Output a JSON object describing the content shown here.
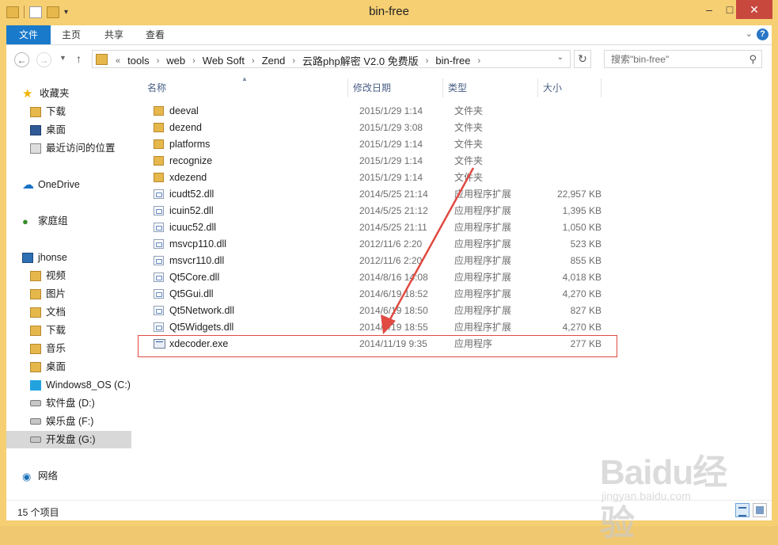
{
  "window": {
    "title": "bin-free"
  },
  "ribbon": {
    "tabs": [
      "文件",
      "主页",
      "共享",
      "查看"
    ]
  },
  "address": {
    "crumbs": [
      "tools",
      "web",
      "Web Soft",
      "Zend",
      "云路php解密 V2.0 免费版",
      "bin-free"
    ],
    "search_placeholder": "搜索\"bin-free\""
  },
  "nav": {
    "favorites_label": "收藏夹",
    "favorites": [
      "下载",
      "桌面",
      "最近访问的位置"
    ],
    "onedrive": "OneDrive",
    "homegroup": "家庭组",
    "pc_label": "jhonse",
    "pc_items": [
      "视频",
      "图片",
      "文档",
      "下载",
      "音乐",
      "桌面",
      "Windows8_OS (C:)",
      "软件盘 (D:)",
      "娱乐盘 (F:)",
      "开发盘 (G:)"
    ],
    "network": "网络"
  },
  "columns": {
    "name": "名称",
    "date": "修改日期",
    "type": "类型",
    "size": "大小"
  },
  "files": [
    {
      "name": "deeval",
      "date": "2015/1/29 1:14",
      "type": "文件夹",
      "size": "",
      "kind": "folder"
    },
    {
      "name": "dezend",
      "date": "2015/1/29 3:08",
      "type": "文件夹",
      "size": "",
      "kind": "folder"
    },
    {
      "name": "platforms",
      "date": "2015/1/29 1:14",
      "type": "文件夹",
      "size": "",
      "kind": "folder"
    },
    {
      "name": "recognize",
      "date": "2015/1/29 1:14",
      "type": "文件夹",
      "size": "",
      "kind": "folder"
    },
    {
      "name": "xdezend",
      "date": "2015/1/29 1:14",
      "type": "文件夹",
      "size": "",
      "kind": "folder"
    },
    {
      "name": "icudt52.dll",
      "date": "2014/5/25 21:14",
      "type": "应用程序扩展",
      "size": "22,957 KB",
      "kind": "dll"
    },
    {
      "name": "icuin52.dll",
      "date": "2014/5/25 21:12",
      "type": "应用程序扩展",
      "size": "1,395 KB",
      "kind": "dll"
    },
    {
      "name": "icuuc52.dll",
      "date": "2014/5/25 21:11",
      "type": "应用程序扩展",
      "size": "1,050 KB",
      "kind": "dll"
    },
    {
      "name": "msvcp110.dll",
      "date": "2012/11/6 2:20",
      "type": "应用程序扩展",
      "size": "523 KB",
      "kind": "dll"
    },
    {
      "name": "msvcr110.dll",
      "date": "2012/11/6 2:20",
      "type": "应用程序扩展",
      "size": "855 KB",
      "kind": "dll"
    },
    {
      "name": "Qt5Core.dll",
      "date": "2014/8/16 14:08",
      "type": "应用程序扩展",
      "size": "4,018 KB",
      "kind": "dll"
    },
    {
      "name": "Qt5Gui.dll",
      "date": "2014/6/19 18:52",
      "type": "应用程序扩展",
      "size": "4,270 KB",
      "kind": "dll"
    },
    {
      "name": "Qt5Network.dll",
      "date": "2014/6/19 18:50",
      "type": "应用程序扩展",
      "size": "827 KB",
      "kind": "dll"
    },
    {
      "name": "Qt5Widgets.dll",
      "date": "2014/6/19 18:55",
      "type": "应用程序扩展",
      "size": "4,270 KB",
      "kind": "dll"
    },
    {
      "name": "xdecoder.exe",
      "date": "2014/11/19 9:35",
      "type": "应用程序",
      "size": "277 KB",
      "kind": "exe"
    }
  ],
  "status": {
    "item_count": "15 个项目"
  },
  "watermark": {
    "logo": "Baidu经验",
    "url": "jingyan.baidu.com"
  },
  "colors": {
    "frame": "#f6cf73",
    "accent": "#1979ca",
    "annotation": "#e04a42"
  }
}
